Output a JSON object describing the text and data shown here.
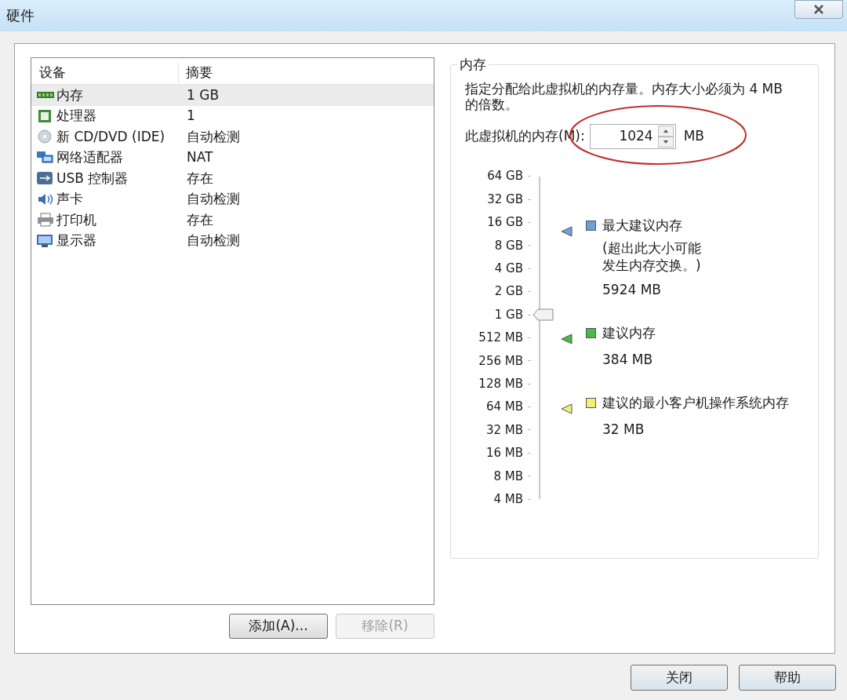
{
  "window": {
    "title": "硬件"
  },
  "device_list": {
    "columns": [
      "设备",
      "摘要"
    ],
    "rows": [
      {
        "kind": "memory",
        "device": "内存",
        "summary": "1 GB",
        "selected": true
      },
      {
        "kind": "cpu",
        "device": "处理器",
        "summary": "1",
        "selected": false
      },
      {
        "kind": "disc",
        "device": "新 CD/DVD (IDE)",
        "summary": "自动检测",
        "selected": false
      },
      {
        "kind": "network",
        "device": "网络适配器",
        "summary": "NAT",
        "selected": false
      },
      {
        "kind": "usb",
        "device": "USB 控制器",
        "summary": "存在",
        "selected": false
      },
      {
        "kind": "sound",
        "device": "声卡",
        "summary": "自动检测",
        "selected": false
      },
      {
        "kind": "printer",
        "device": "打印机",
        "summary": "存在",
        "selected": false
      },
      {
        "kind": "display",
        "device": "显示器",
        "summary": "自动检测",
        "selected": false
      }
    ]
  },
  "list_buttons": [
    {
      "label": "添加(A)...",
      "disabled": false
    },
    {
      "label": "移除(R)",
      "disabled": true
    }
  ],
  "memory": {
    "title": "内存",
    "description": "指定分配给此虚拟机的内存量。内存大小必须为 4 MB 的倍数。",
    "field_label": "此虚拟机的内存(M):",
    "value": "1024",
    "unit": "MB",
    "scale": [
      "64 GB",
      "32 GB",
      "16 GB",
      "8 GB",
      "4 GB",
      "2 GB",
      "1 GB",
      "512 MB",
      "256 MB",
      "128 MB",
      "64 MB",
      "32 MB",
      "16 MB",
      "8 MB",
      "4 MB"
    ],
    "level": 0.571,
    "legend": [
      {
        "label": "最大建议内存",
        "note_lines": [
          "(超出此大小可能",
          "发生内存交换。)"
        ],
        "value": "5924 MB",
        "color": "#6f9fd8"
      },
      {
        "label": "建议内存",
        "value": "384 MB",
        "color": "#4cb847"
      },
      {
        "label": "建议的最小客户机操作系统内存",
        "value": "32 MB",
        "color": "#f2ee7a"
      }
    ]
  },
  "footer_buttons": [
    "关闭",
    "帮助"
  ]
}
